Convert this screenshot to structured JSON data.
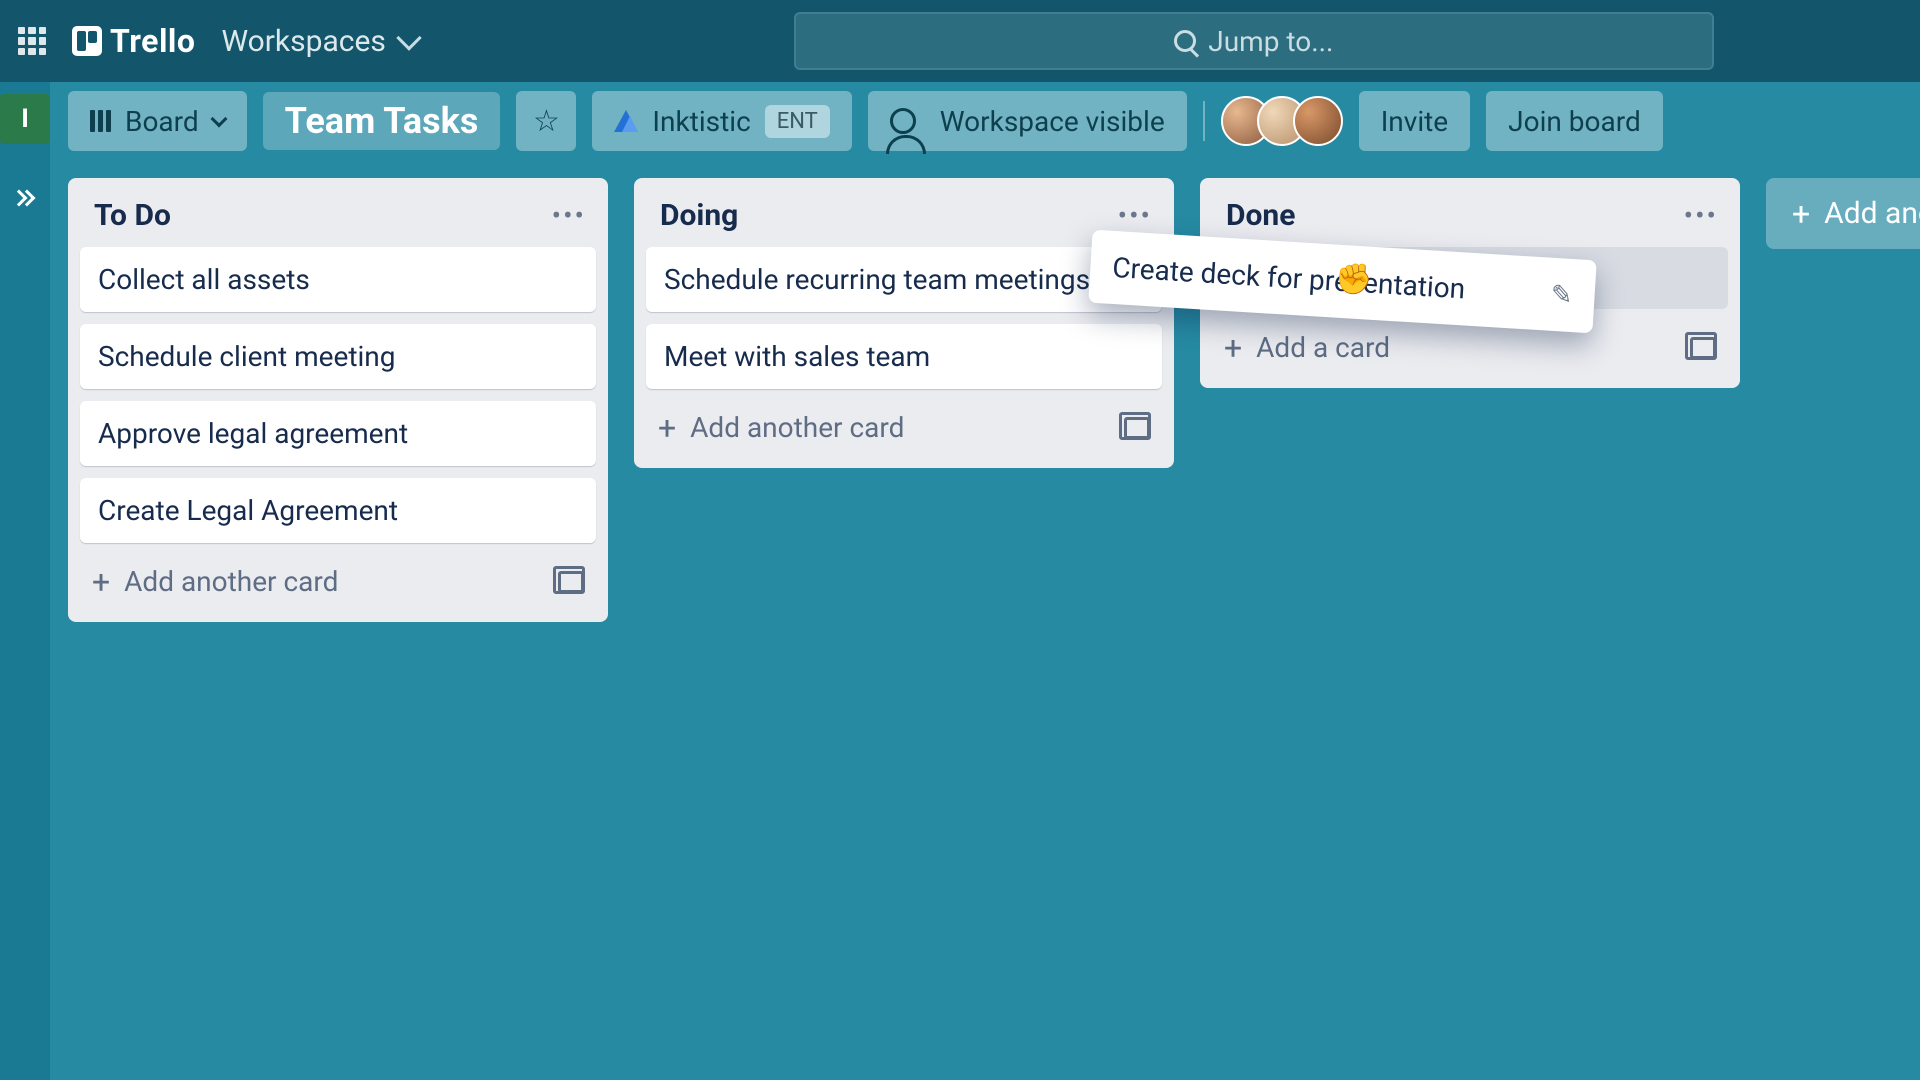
{
  "topnav": {
    "logo_text": "Trello",
    "workspaces_label": "Workspaces",
    "search_placeholder": "Jump to..."
  },
  "left_rail": {
    "square_letter": "I"
  },
  "board_header": {
    "view_label": "Board",
    "board_title": "Team Tasks",
    "org_name": "Inktistic",
    "org_badge": "ENT",
    "visibility_label": "Workspace visible",
    "invite_label": "Invite",
    "join_label": "Join board"
  },
  "lists": [
    {
      "title": "To Do",
      "cards": [
        "Collect all assets",
        "Schedule client meeting",
        "Approve legal agreement",
        "Create Legal Agreement"
      ],
      "add_label": "Add another card"
    },
    {
      "title": "Doing",
      "cards": [
        "Schedule recurring team meetings",
        "Meet with sales team"
      ],
      "add_label": "Add another card"
    },
    {
      "title": "Done",
      "cards": [],
      "placeholder": true,
      "add_label": "Add a card"
    }
  ],
  "add_list_label": "Add another list",
  "dragged_card": {
    "text": "Create deck for presentation"
  }
}
